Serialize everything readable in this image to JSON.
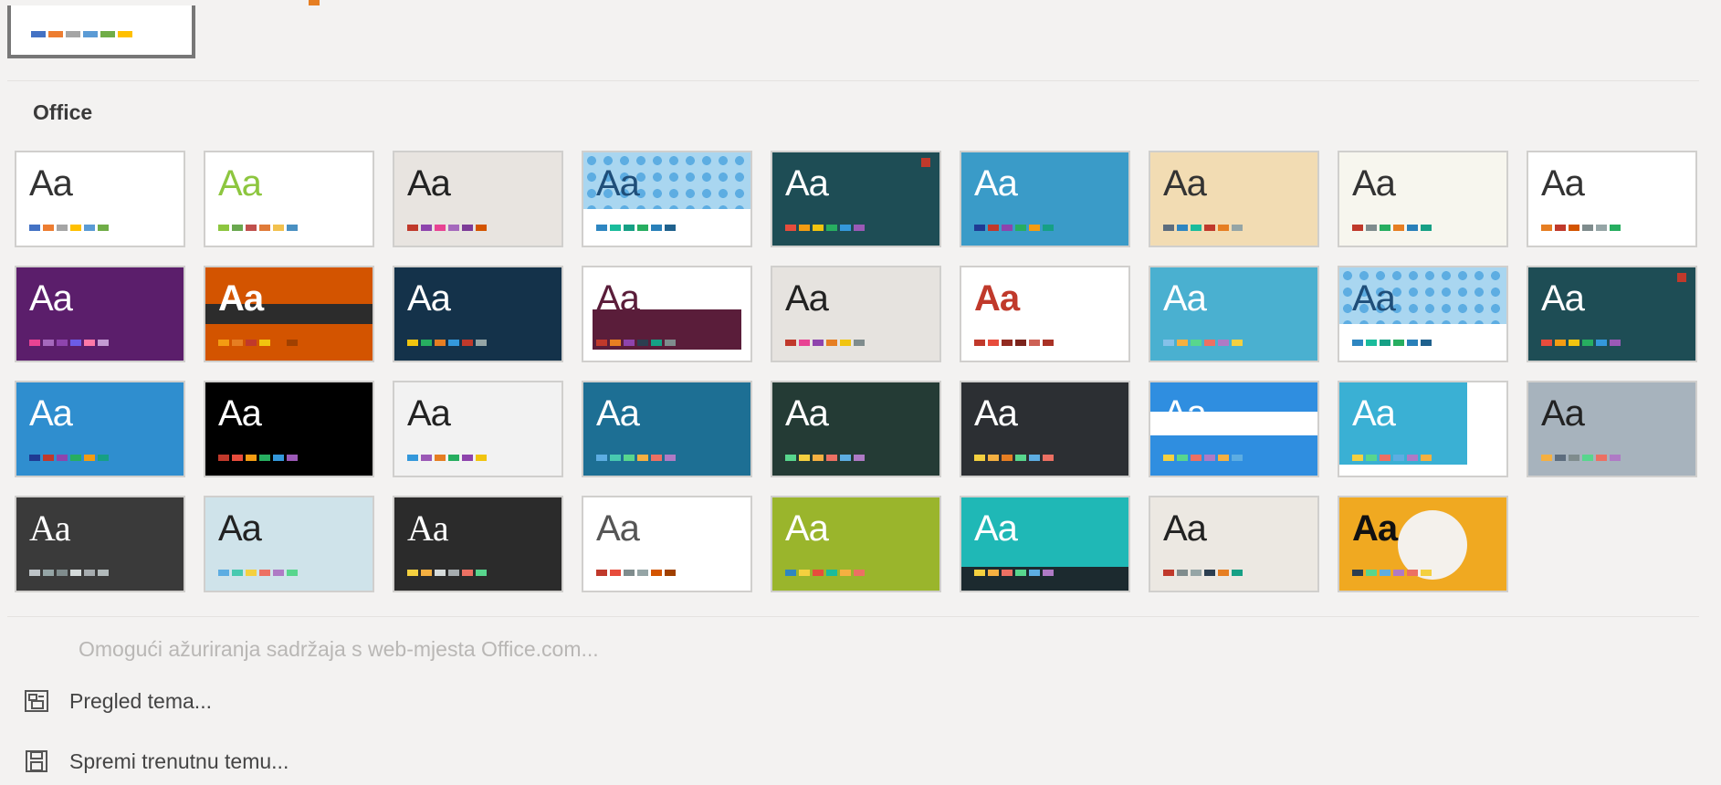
{
  "section_title": "Office",
  "footer": {
    "enable_updates": "Omogući ažuriranja sadržaja s web-mjesta Office.com...",
    "browse_themes": "Pregled tema...",
    "save_theme": "Spremi trenutnu temu..."
  },
  "current_theme": {
    "palette": [
      "#4472c4",
      "#ed7d31",
      "#a5a5a5",
      "#5b9bd5",
      "#70ad47",
      "#ffc000"
    ]
  },
  "themes": [
    {
      "label": "Aa",
      "bg": "#ffffff",
      "fg": "#333333",
      "palette": [
        "#4472c4",
        "#ed7d31",
        "#a5a5a5",
        "#ffc000",
        "#5b9bd5",
        "#70ad47"
      ]
    },
    {
      "label": "Aa",
      "bg": "#ffffff",
      "fg": "#8dc63f",
      "palette": [
        "#8dc63f",
        "#6aa84f",
        "#c0504d",
        "#e07b39",
        "#f2c14e",
        "#4a90c2"
      ]
    },
    {
      "label": "Aa",
      "bg": "#e8e4e0",
      "fg": "#222222",
      "palette": [
        "#c0392b",
        "#8e44ad",
        "#e84393",
        "#a569bd",
        "#7d3c98",
        "#d35400"
      ]
    },
    {
      "label": "Aa",
      "bg": "#ffffff",
      "fg": "#1f4e79",
      "palette": [
        "#2e86c1",
        "#1abc9c",
        "#16a085",
        "#27ae60",
        "#2980b9",
        "#1f618d"
      ]
    },
    {
      "label": "Aa",
      "bg": "#1e4d55",
      "fg": "#ffffff",
      "palette": [
        "#e74c3c",
        "#f39c12",
        "#f1c40f",
        "#27ae60",
        "#3498db",
        "#9b59b6"
      ]
    },
    {
      "label": "Aa",
      "bg": "#3a9bc8",
      "fg": "#ffffff",
      "palette": [
        "#1f3a93",
        "#c0392b",
        "#8e44ad",
        "#27ae60",
        "#f39c12",
        "#16a085"
      ]
    },
    {
      "label": "Aa",
      "bg": "#f2dcb3",
      "fg": "#333333",
      "palette": [
        "#5d6d7e",
        "#2e86c1",
        "#1abc9c",
        "#c0392b",
        "#e67e22",
        "#95a5a6"
      ]
    },
    {
      "label": "Aa",
      "bg": "#f7f6ee",
      "fg": "#333333",
      "palette": [
        "#c0392b",
        "#7f8c8d",
        "#27ae60",
        "#e67e22",
        "#2980b9",
        "#16a085"
      ]
    },
    {
      "label": "Aa",
      "bg": "#ffffff",
      "fg": "#333333",
      "palette": [
        "#e67e22",
        "#c0392b",
        "#d35400",
        "#7f8c8d",
        "#95a5a6",
        "#27ae60"
      ]
    },
    {
      "label": "Aa",
      "bg": "#5b1e6b",
      "fg": "#ffffff",
      "palette": [
        "#e84393",
        "#a569bd",
        "#8e44ad",
        "#6c5ce7",
        "#fd79a8",
        "#c39bd3"
      ]
    },
    {
      "label": "Aa",
      "bg": "#d35400",
      "fg": "#ffffff",
      "palette": [
        "#f39c12",
        "#e67e22",
        "#c0392b",
        "#f1c40f",
        "#d35400",
        "#a04000"
      ]
    },
    {
      "label": "Aa",
      "bg": "#14324a",
      "fg": "#ffffff",
      "palette": [
        "#f1c40f",
        "#27ae60",
        "#e67e22",
        "#3498db",
        "#c0392b",
        "#95a5a6"
      ]
    },
    {
      "label": "Aa",
      "bg": "#ffffff",
      "fg": "#5a1d3a",
      "palette": [
        "#c0392b",
        "#e67e22",
        "#8e44ad",
        "#2c3e50",
        "#16a085",
        "#7f8c8d"
      ]
    },
    {
      "label": "Aa",
      "bg": "#e6e3df",
      "fg": "#222222",
      "palette": [
        "#c0392b",
        "#e84393",
        "#8e44ad",
        "#e67e22",
        "#f1c40f",
        "#7f8c8d"
      ]
    },
    {
      "label": "Aa",
      "bg": "#ffffff",
      "fg": "#c0392b",
      "palette": [
        "#c0392b",
        "#e74c3c",
        "#922b21",
        "#7b241c",
        "#cd6155",
        "#a93226"
      ]
    },
    {
      "label": "Aa",
      "bg": "#4ab0d0",
      "fg": "#ffffff",
      "palette": [
        "#85c1e9",
        "#f5b041",
        "#58d68d",
        "#ec7063",
        "#af7ac5",
        "#f4d03f"
      ]
    },
    {
      "label": "Aa",
      "bg": "#ffffff",
      "fg": "#1f4e79",
      "palette": [
        "#2e86c1",
        "#1abc9c",
        "#16a085",
        "#27ae60",
        "#2980b9",
        "#1f618d"
      ]
    },
    {
      "label": "Aa",
      "bg": "#1e4d55",
      "fg": "#ffffff",
      "palette": [
        "#e74c3c",
        "#f39c12",
        "#f1c40f",
        "#27ae60",
        "#3498db",
        "#9b59b6"
      ]
    },
    {
      "label": "Aa",
      "bg": "#2f8ecf",
      "fg": "#ffffff",
      "palette": [
        "#1f3a93",
        "#c0392b",
        "#8e44ad",
        "#27ae60",
        "#f39c12",
        "#16a085"
      ]
    },
    {
      "label": "Aa",
      "bg": "#000000",
      "fg": "#ffffff",
      "palette": [
        "#c0392b",
        "#e74c3c",
        "#f39c12",
        "#27ae60",
        "#3498db",
        "#9b59b6"
      ]
    },
    {
      "label": "Aa",
      "bg": "#f2f2f2",
      "fg": "#222222",
      "palette": [
        "#3498db",
        "#9b59b6",
        "#e67e22",
        "#27ae60",
        "#8e44ad",
        "#f1c40f"
      ]
    },
    {
      "label": "Aa",
      "bg": "#1d6f94",
      "fg": "#ffffff",
      "palette": [
        "#5dade2",
        "#48c9b0",
        "#58d68d",
        "#f5b041",
        "#ec7063",
        "#af7ac5"
      ]
    },
    {
      "label": "Aa",
      "bg": "#243b35",
      "fg": "#ffffff",
      "palette": [
        "#58d68d",
        "#f4d03f",
        "#f5b041",
        "#ec7063",
        "#5dade2",
        "#af7ac5"
      ]
    },
    {
      "label": "Aa",
      "bg": "#2c2f33",
      "fg": "#ffffff",
      "palette": [
        "#f4d03f",
        "#f5b041",
        "#e67e22",
        "#58d68d",
        "#5dade2",
        "#ec7063"
      ]
    },
    {
      "label": "Aa",
      "bg": "#2f8ee0",
      "fg": "#ffffff",
      "palette": [
        "#f4d03f",
        "#58d68d",
        "#ec7063",
        "#af7ac5",
        "#f5b041",
        "#5dade2"
      ]
    },
    {
      "label": "Aa",
      "bg": "#ffffff",
      "fg": "#ffffff",
      "palette": [
        "#f4d03f",
        "#58d68d",
        "#ec7063",
        "#5dade2",
        "#af7ac5",
        "#f5b041"
      ]
    },
    {
      "label": "Aa",
      "bg": "#a7b3bd",
      "fg": "#222222",
      "palette": [
        "#f5b041",
        "#5d6d7e",
        "#7f8c8d",
        "#58d68d",
        "#ec7063",
        "#af7ac5"
      ]
    },
    {
      "label": "Aa",
      "bg": "#3a3a3a",
      "fg": "#ffffff",
      "palette": [
        "#bdc3c7",
        "#95a5a6",
        "#7f8c8d",
        "#d5dbdb",
        "#a6acaf",
        "#b2babb"
      ]
    },
    {
      "label": "Aa",
      "bg": "#cfe3ea",
      "fg": "#222222",
      "palette": [
        "#5dade2",
        "#48c9b0",
        "#f4d03f",
        "#ec7063",
        "#af7ac5",
        "#58d68d"
      ]
    },
    {
      "label": "Aa",
      "bg": "#2b2b2b",
      "fg": "#ffffff",
      "palette": [
        "#f4d03f",
        "#f5b041",
        "#d5dbdb",
        "#a6acaf",
        "#ec7063",
        "#58d68d"
      ]
    },
    {
      "label": "Aa",
      "bg": "#ffffff",
      "fg": "#555555",
      "palette": [
        "#c0392b",
        "#e74c3c",
        "#7f8c8d",
        "#95a5a6",
        "#d35400",
        "#a04000"
      ]
    },
    {
      "label": "Aa",
      "bg": "#9ab52c",
      "fg": "#ffffff",
      "palette": [
        "#2e86c1",
        "#f4d03f",
        "#e74c3c",
        "#1abc9c",
        "#f5b041",
        "#ec7063"
      ]
    },
    {
      "label": "Aa",
      "bg": "#1fb8b6",
      "fg": "#ffffff",
      "palette": [
        "#f4d03f",
        "#f5b041",
        "#ec7063",
        "#58d68d",
        "#5dade2",
        "#af7ac5"
      ]
    },
    {
      "label": "Aa",
      "bg": "#ece8e2",
      "fg": "#222222",
      "palette": [
        "#c0392b",
        "#7f8c8d",
        "#95a5a6",
        "#2c3e50",
        "#e67e22",
        "#16a085"
      ]
    },
    {
      "label": "Aa",
      "bg": "#f0a921",
      "fg": "#111111",
      "palette": [
        "#2c3e50",
        "#58d68d",
        "#5dade2",
        "#af7ac5",
        "#ec7063",
        "#f4d03f"
      ]
    }
  ]
}
